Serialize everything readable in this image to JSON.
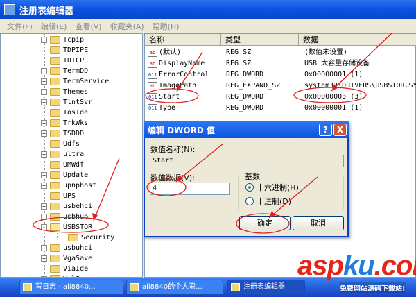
{
  "window": {
    "title": "注册表编辑器"
  },
  "menu": [
    "文件(F)",
    "编辑(E)",
    "查看(V)",
    "收藏夹(A)",
    "帮助(H)"
  ],
  "tree": {
    "items": [
      {
        "label": "Tcpip",
        "expander": "+"
      },
      {
        "label": "TDPIPE",
        "expander": ""
      },
      {
        "label": "TDTCP",
        "expander": ""
      },
      {
        "label": "TermDD",
        "expander": "+"
      },
      {
        "label": "TermService",
        "expander": "+"
      },
      {
        "label": "Themes",
        "expander": "+"
      },
      {
        "label": "TlntSvr",
        "expander": "+"
      },
      {
        "label": "TosIde",
        "expander": ""
      },
      {
        "label": "TrkWks",
        "expander": "+"
      },
      {
        "label": "TSDDD",
        "expander": "+"
      },
      {
        "label": "Udfs",
        "expander": ""
      },
      {
        "label": "ultra",
        "expander": "+"
      },
      {
        "label": "UMWdf",
        "expander": ""
      },
      {
        "label": "Update",
        "expander": "+"
      },
      {
        "label": "upnphost",
        "expander": "+"
      },
      {
        "label": "UPS",
        "expander": ""
      },
      {
        "label": "usbehci",
        "expander": "+"
      },
      {
        "label": "usbhub",
        "expander": "+"
      },
      {
        "label": "USBSTOR",
        "expander": "-"
      },
      {
        "label": "Security",
        "expander": "",
        "child": true
      },
      {
        "label": "usbuhci",
        "expander": "+"
      },
      {
        "label": "VgaSave",
        "expander": "+"
      },
      {
        "label": "ViaIde",
        "expander": ""
      },
      {
        "label": "VolSnap",
        "expander": "+"
      }
    ]
  },
  "list": {
    "columns": [
      "名称",
      "类型",
      "数据"
    ],
    "rows": [
      {
        "icon": "ab",
        "name": "(默认)",
        "type": "REG_SZ",
        "data": "(数值未设置)"
      },
      {
        "icon": "ab",
        "name": "DisplayName",
        "type": "REG_SZ",
        "data": "USB 大容量存储设备"
      },
      {
        "icon": "011",
        "name": "ErrorControl",
        "type": "REG_DWORD",
        "data": "0x00000001 (1)"
      },
      {
        "icon": "ab",
        "name": "ImagePath",
        "type": "REG_EXPAND_SZ",
        "data": "system32\\DRIVERS\\USBSTOR.SYS"
      },
      {
        "icon": "011",
        "name": "Start",
        "type": "REG_DWORD",
        "data": "0x00000003 (3)"
      },
      {
        "icon": "011",
        "name": "Type",
        "type": "REG_DWORD",
        "data": "0x00000001 (1)"
      }
    ]
  },
  "dialog": {
    "title": "编辑 DWORD 值",
    "help_label": "?",
    "close_label": "X",
    "name_label": "数值名称(N):",
    "name_value": "Start",
    "data_label": "数值数据(V):",
    "data_value": "4",
    "base_label": "基数",
    "hex_label": "十六进制(H)",
    "dec_label": "十进制(D)",
    "selected_base": "hex",
    "ok_label": "确定",
    "cancel_label": "取消"
  },
  "taskbar": {
    "items": [
      {
        "label": "写日志 - ali8840...",
        "active": false
      },
      {
        "label": "ali8840的个人资...",
        "active": false
      },
      {
        "label": "注册表编辑器",
        "active": true
      }
    ]
  },
  "watermark": {
    "logo_a": "asp",
    "logo_b": "ku",
    "logo_c": ".com",
    "sub": "免费网站源码下载站!"
  },
  "colors": {
    "title_blue": "#0a54e0",
    "annotation_red": "#e0201a",
    "folder": "#f4d67a"
  }
}
